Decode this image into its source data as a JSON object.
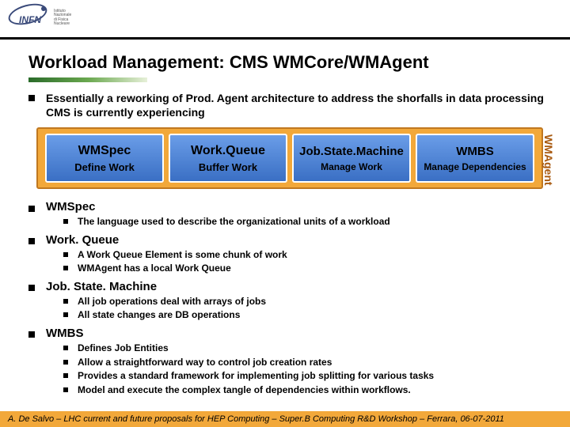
{
  "logo": {
    "text": "INFN",
    "sub1": "Istituto Nazionale",
    "sub2": "di Fisica Nucleare"
  },
  "title": "Workload Management: CMS WMCore/WMAgent",
  "intro": "Essentially a reworking of Prod. Agent architecture to address the shorfalls in data processing CMS is currently experiencing",
  "diagram": {
    "boxes": [
      {
        "title": "WMSpec",
        "sub": "Define Work"
      },
      {
        "title": "Work.Queue",
        "sub": "Buffer Work"
      },
      {
        "title": "Job.State.Machine",
        "sub": "Manage Work"
      },
      {
        "title": "WMBS",
        "sub": "Manage Dependencies"
      }
    ],
    "side": "WMAgent"
  },
  "sections": [
    {
      "title": "WMSpec",
      "items": [
        "The language used to describe the organizational units of a workload"
      ]
    },
    {
      "title": "Work. Queue",
      "items": [
        "A Work Queue Element is some chunk of work",
        "WMAgent has a local Work Queue"
      ]
    },
    {
      "title": "Job. State. Machine",
      "items": [
        "All job operations deal with arrays of jobs",
        "All state changes are DB operations"
      ]
    },
    {
      "title": "WMBS",
      "items": [
        "Defines Job Entities",
        "Allow a straightforward way to control job creation rates",
        "Provides a standard framework for implementing job splitting for various tasks",
        "Model and execute the complex tangle of dependencies within workflows."
      ]
    }
  ],
  "footer": "A. De Salvo – LHC current and future proposals for HEP Computing – Super.B Computing R&D Workshop – Ferrara, 06-07-2011"
}
